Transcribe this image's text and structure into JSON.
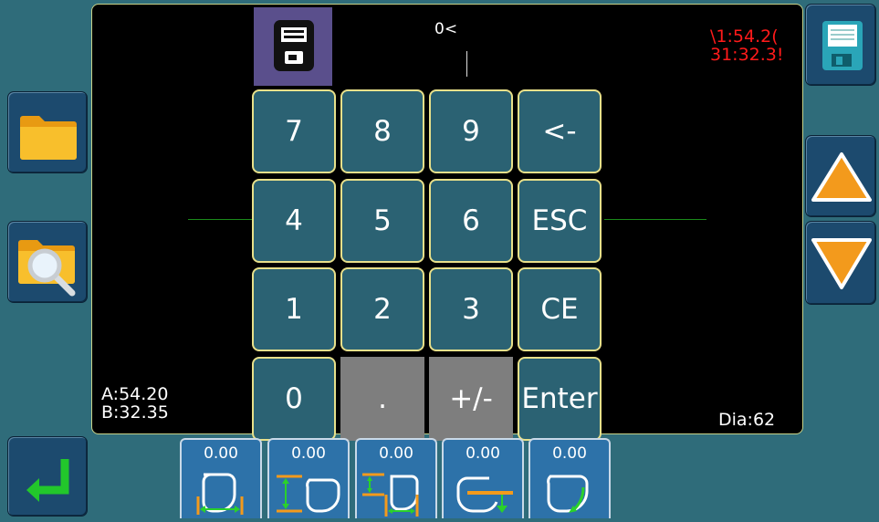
{
  "display": {
    "input": "0<",
    "red_readout": {
      "a": "\\1:54.2(",
      "b": "31:32.3!"
    },
    "a_value": "A:54.20",
    "b_value": "B:32.35",
    "diameter": "Dia:62"
  },
  "keypad": {
    "keys": [
      "7",
      "8",
      "9",
      "<-",
      "4",
      "5",
      "6",
      "ESC",
      "1",
      "2",
      "3",
      "CE",
      "0",
      ".",
      "+/-",
      "Enter"
    ]
  },
  "tools": [
    {
      "value": "0.00",
      "icon": "lens-width-icon"
    },
    {
      "value": "0.00",
      "icon": "lens-height-bridge-icon"
    },
    {
      "value": "0.00",
      "icon": "lens-height-width-icon"
    },
    {
      "value": "0.00",
      "icon": "lens-drop-icon"
    },
    {
      "value": "0.00",
      "icon": "lens-bevel-icon"
    }
  ],
  "colors": {
    "background": "#2f6c7a",
    "key": "#2b6273",
    "key_border": "#e8e08a",
    "red_text": "#ff1a1a",
    "accent_orange": "#f39a1c"
  }
}
